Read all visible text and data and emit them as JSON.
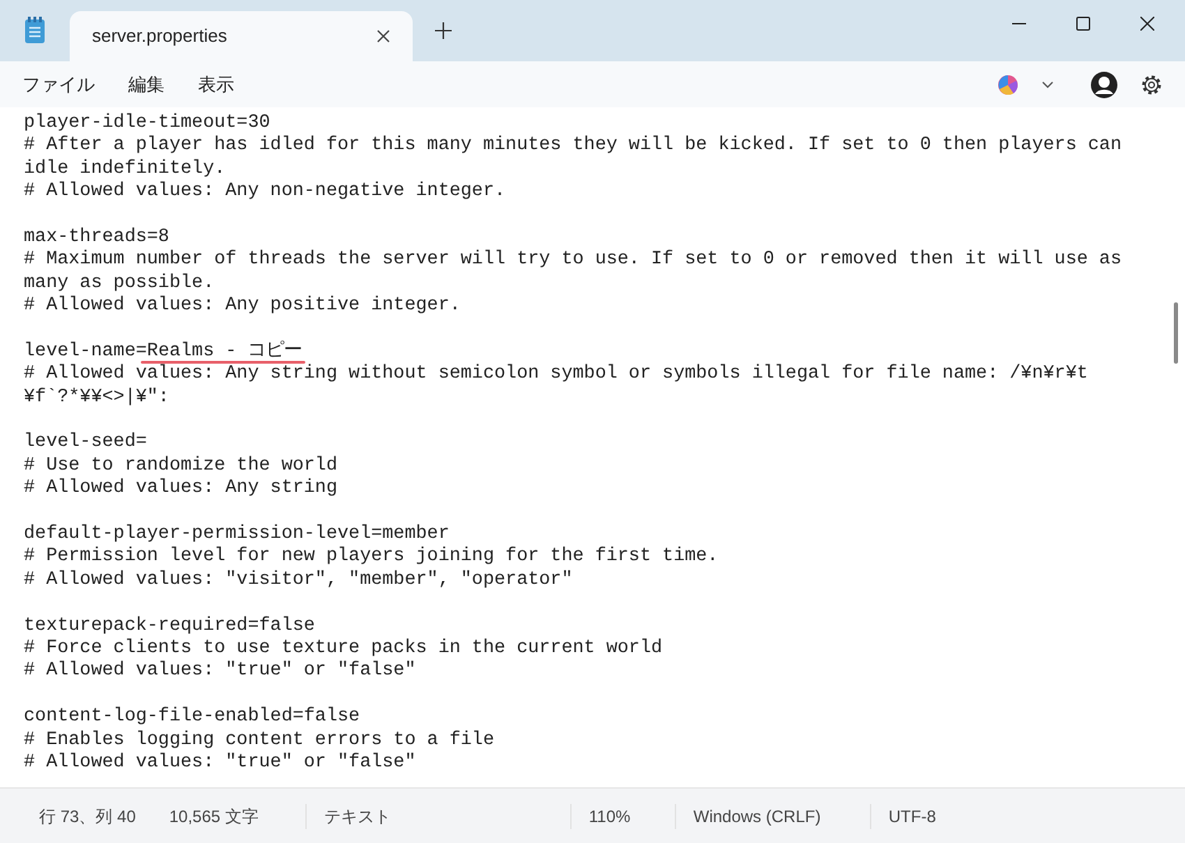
{
  "window": {
    "tab_title": "server.properties",
    "tab_selected": true
  },
  "menu": [
    "ファイル",
    "編集",
    "表示"
  ],
  "blocks": [
    {
      "lines": [
        {
          "text": "player-idle-timeout=30"
        },
        {
          "text": "# After a player has idled for this many minutes they will be kicked. If set to 0 then players can"
        },
        {
          "text": "idle indefinitely."
        },
        {
          "text": "# Allowed values: Any non-negative integer."
        }
      ]
    },
    {
      "lines": [
        {
          "text": "max-threads=8"
        },
        {
          "text": "# Maximum number of threads the server will try to use. If set to 0 or removed then it will use as"
        },
        {
          "text": "many as possible."
        },
        {
          "text": "# Allowed values: Any positive integer."
        }
      ]
    },
    {
      "lines": [
        {
          "text": "level-name=",
          "marked": "Realms - コピー"
        },
        {
          "text": "# Allowed values: Any string without semicolon symbol or symbols illegal for file name: /¥n¥r¥t"
        },
        {
          "text": "¥f`?*¥¥<>|¥\":"
        }
      ]
    },
    {
      "lines": [
        {
          "text": "level-seed="
        },
        {
          "text": "# Use to randomize the world"
        },
        {
          "text": "# Allowed values: Any string"
        }
      ]
    },
    {
      "lines": [
        {
          "text": "default-player-permission-level=member"
        },
        {
          "text": "# Permission level for new players joining for the first time."
        },
        {
          "text": "# Allowed values: \"visitor\", \"member\", \"operator\""
        }
      ]
    },
    {
      "lines": [
        {
          "text": "texturepack-required=false"
        },
        {
          "text": "# Force clients to use texture packs in the current world"
        },
        {
          "text": "# Allowed values: \"true\" or \"false\""
        }
      ]
    },
    {
      "lines": [
        {
          "text": "content-log-file-enabled=false"
        },
        {
          "text": "# Enables logging content errors to a file"
        },
        {
          "text": "# Allowed values: \"true\" or \"false\""
        }
      ]
    }
  ],
  "status_bar": [
    "行 73、列 40",
    "10,565 文字",
    "テキスト",
    "110%",
    "Windows (CRLF)",
    "UTF-8"
  ]
}
